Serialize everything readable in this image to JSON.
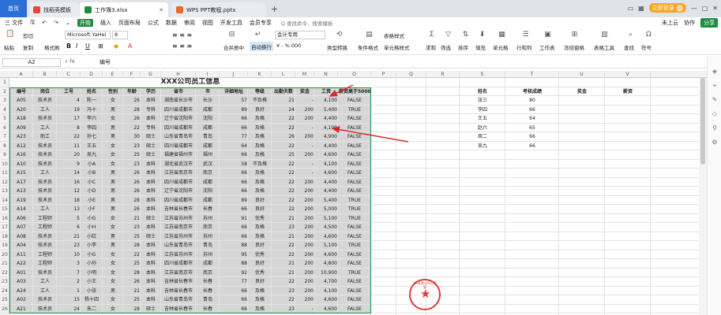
{
  "tabs": [
    {
      "label": "首页",
      "type": "home"
    },
    {
      "label": "找稻壳模板",
      "icon_color": "#e8453c"
    },
    {
      "label": "工作簿3.xlsx",
      "icon_color": "#1a8f3f",
      "active": true
    },
    {
      "label": "WPS PPT教程.pptx",
      "icon_color": "#e86a2c"
    }
  ],
  "titlebar": {
    "login_label": "立即登录"
  },
  "menu": {
    "file_label": "三 文件",
    "items": [
      "开始",
      "插入",
      "页面布局",
      "公式",
      "数据",
      "审阅",
      "视图",
      "开发工具",
      "会员专享"
    ],
    "active": "开始",
    "search_placeholder": "Q 查找命令、搜索模板",
    "right": {
      "cloud": "未上云",
      "collab": "协作",
      "share": "分享"
    }
  },
  "ribbon": {
    "cut": "剪切",
    "paste": "粘贴",
    "copy": "复制",
    "format_painter": "格式刷",
    "font_name": "Microsoft YaHei",
    "font_size": "8",
    "merge": "合并居中",
    "wrap": "自动换行",
    "number_format": "会计专用",
    "type_convert": "类型转换",
    "cond_format": "条件格式",
    "table_style": "表格样式",
    "cell_style": "单元格样式",
    "sum": "求和",
    "filter": "筛选",
    "sort": "排序",
    "fill": "填充",
    "cell": "单元格",
    "rowcol": "行和列",
    "sheet": "工作表",
    "freeze": "冻结窗格",
    "table_tools": "表格工具",
    "find": "查找",
    "symbol": "符号"
  },
  "formula": {
    "name_box": "A2",
    "fx": "fx",
    "value": "编号"
  },
  "columns": [
    "A",
    "B",
    "C",
    "D",
    "E",
    "F",
    "G",
    "H",
    "I",
    "J",
    "K",
    "L",
    "M",
    "N",
    "O",
    "P",
    "Q",
    "R",
    "S",
    "T",
    "U",
    "V"
  ],
  "rows": [
    "1",
    "2",
    "3",
    "4",
    "5",
    "6",
    "7",
    "8",
    "9",
    "10",
    "11",
    "12",
    "13",
    "14",
    "15",
    "16",
    "17",
    "18",
    "19",
    "20",
    "21",
    "22",
    "23",
    "24",
    "25",
    "26"
  ],
  "sheet": {
    "title": "XXX公司员工信息",
    "headers": [
      "编号",
      "岗位",
      "工号",
      "姓名",
      "性别",
      "年龄",
      "学历",
      "省市",
      "市",
      "详细地址",
      "等级",
      "出勤天数",
      "奖金",
      "工资",
      "薪资高于5000"
    ],
    "rows": [
      [
        "A05",
        "技术员",
        "4",
        "陈一",
        "女",
        "26",
        "本科",
        "湖南省长沙市",
        "长沙",
        "57",
        "不及格",
        "21",
        "-",
        "4,100",
        "FALSE"
      ],
      [
        "A20",
        "工人",
        "19",
        "冯十",
        "男",
        "28",
        "专科",
        "四川省成都市",
        "成都",
        "89",
        "良好",
        "24",
        "200",
        "5,400",
        "TRUE"
      ],
      [
        "A18",
        "技术员",
        "17",
        "李六",
        "女",
        "26",
        "本科",
        "辽宁省沈阳市",
        "沈阳",
        "66",
        "及格",
        "22",
        "200",
        "4,400",
        "FALSE"
      ],
      [
        "A09",
        "工人",
        "8",
        "李四",
        "男",
        "22",
        "专科",
        "四川省成都市",
        "成都",
        "66",
        "及格",
        "22",
        "-",
        "4,100",
        "FALSE"
      ],
      [
        "A23",
        "助工",
        "22",
        "孙七",
        "男",
        "30",
        "硕士",
        "山东省青岛市",
        "青岛",
        "77",
        "及格",
        "26",
        "200",
        "4,900",
        "FALSE"
      ],
      [
        "A12",
        "技术员",
        "11",
        "王五",
        "女",
        "23",
        "硕士",
        "四川省成都市",
        "成都",
        "64",
        "及格",
        "22",
        "-",
        "4,400",
        "FALSE"
      ],
      [
        "A16",
        "技术员",
        "20",
        "吴九",
        "女",
        "25",
        "硕士",
        "福建省福州市",
        "福州",
        "66",
        "及格",
        "25",
        "200",
        "4,600",
        "FALSE"
      ],
      [
        "A10",
        "技术员",
        "9",
        "小A",
        "女",
        "23",
        "本科",
        "湖北省武汉市",
        "武汉",
        "58",
        "不及格",
        "22",
        "-",
        "4,100",
        "FALSE"
      ],
      [
        "A15",
        "工人",
        "14",
        "小B",
        "男",
        "26",
        "本科",
        "江苏省南京市",
        "南京",
        "66",
        "及格",
        "22",
        "-",
        "4,600",
        "FALSE"
      ],
      [
        "A17",
        "技术员",
        "16",
        "小C",
        "男",
        "26",
        "本科",
        "四川省成都市",
        "成都",
        "66",
        "及格",
        "22",
        "200",
        "4,400",
        "FALSE"
      ],
      [
        "A13",
        "技术员",
        "12",
        "小D",
        "男",
        "26",
        "本科",
        "辽宁省沈阳市",
        "沈阳",
        "66",
        "及格",
        "22",
        "200",
        "4,400",
        "FALSE"
      ],
      [
        "A19",
        "技术员",
        "18",
        "小E",
        "男",
        "28",
        "本科",
        "四川省成都市",
        "成都",
        "89",
        "良好",
        "22",
        "200",
        "5,400",
        "TRUE"
      ],
      [
        "A14",
        "工人",
        "13",
        "小F",
        "男",
        "26",
        "本科",
        "吉林省长春市",
        "长春",
        "66",
        "良好",
        "22",
        "200",
        "5,000",
        "TRUE"
      ],
      [
        "A06",
        "工程师",
        "5",
        "小G",
        "女",
        "21",
        "硕士",
        "江苏省苏州市",
        "苏州",
        "91",
        "优秀",
        "21",
        "200",
        "5,100",
        "TRUE"
      ],
      [
        "A07",
        "工程师",
        "6",
        "小H",
        "女",
        "23",
        "本科",
        "江苏省南京市",
        "南京",
        "66",
        "及格",
        "23",
        "200",
        "4,500",
        "FALSE"
      ],
      [
        "A08",
        "技术员",
        "21",
        "小红",
        "男",
        "25",
        "硕士",
        "江苏省苏州市",
        "苏州",
        "66",
        "及格",
        "21",
        "200",
        "4,600",
        "FALSE"
      ],
      [
        "A04",
        "技术员",
        "23",
        "小李",
        "男",
        "28",
        "本科",
        "山东省青岛市",
        "青岛",
        "88",
        "良好",
        "22",
        "200",
        "5,100",
        "TRUE"
      ],
      [
        "A11",
        "工程师",
        "10",
        "小G",
        "女",
        "22",
        "本科",
        "江苏省苏州市",
        "苏州",
        "95",
        "优秀",
        "22",
        "200",
        "4,600",
        "FALSE"
      ],
      [
        "A22",
        "工程师",
        "3",
        "小孙",
        "女",
        "25",
        "本科",
        "四川省成都市",
        "成都",
        "88",
        "良好",
        "21",
        "200",
        "4,800",
        "FALSE"
      ],
      [
        "A01",
        "技术员",
        "7",
        "小明",
        "女",
        "28",
        "本科",
        "江苏省南京市",
        "南京",
        "92",
        "优秀",
        "21",
        "200",
        "10,900",
        "TRUE"
      ],
      [
        "A03",
        "工人",
        "2",
        "小王",
        "女",
        "26",
        "本科",
        "吉林省长春市",
        "长春",
        "77",
        "良好",
        "22",
        "200",
        "4,700",
        "FALSE"
      ],
      [
        "A24",
        "工人",
        "1",
        "小张",
        "男",
        "21",
        "本科",
        "吉林省长春市",
        "长春",
        "66",
        "及格",
        "23",
        "200",
        "4,100",
        "FALSE"
      ],
      [
        "A02",
        "技术员",
        "15",
        "杨十四",
        "女",
        "25",
        "本科",
        "山东省青岛市",
        "青岛",
        "66",
        "及格",
        "22",
        "200",
        "4,600",
        "FALSE"
      ],
      [
        "A21",
        "技术员",
        "24",
        "朱二",
        "女",
        "28",
        "硕士",
        "吉林省长春市",
        "长春",
        "66",
        "及格",
        "23",
        "-",
        "4,600",
        "FALSE"
      ]
    ]
  },
  "side_table": {
    "headers": [
      "姓名",
      "考核成绩",
      "奖金",
      "薪资"
    ],
    "rows": [
      [
        "张三",
        "80"
      ],
      [
        "李四",
        "66"
      ],
      [
        "王五",
        "64"
      ],
      [
        "赵六",
        "65"
      ],
      [
        "周二",
        "66"
      ],
      [
        "吴九",
        "66"
      ]
    ]
  },
  "stamp": {
    "text": "XX有限公司人事部"
  }
}
